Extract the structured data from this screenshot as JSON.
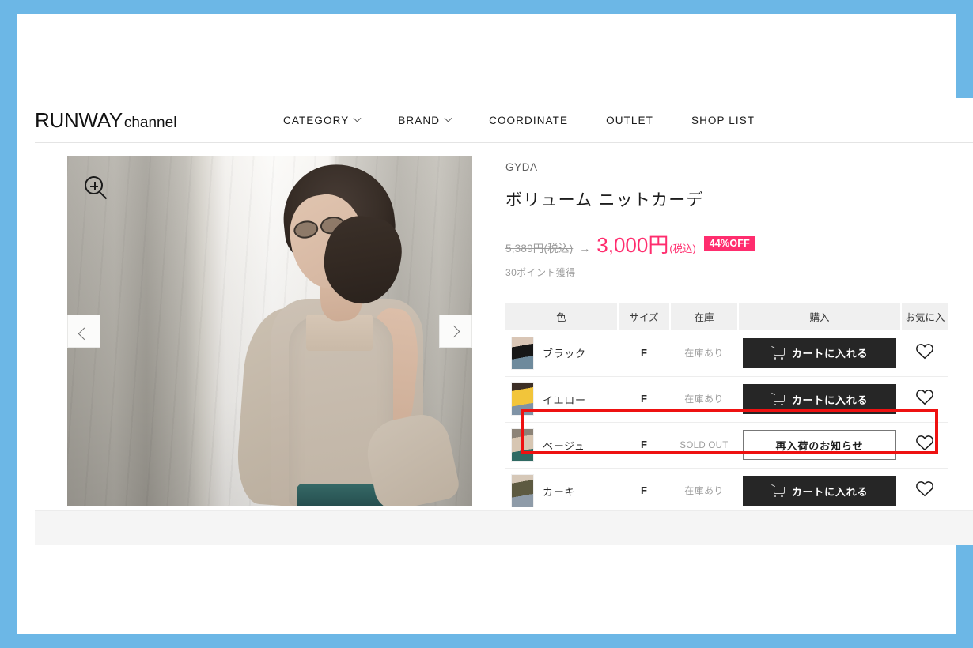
{
  "frame": {
    "border_color": "#6cb7e6",
    "page_bg": "#ffffff"
  },
  "header": {
    "logo_main": "RUNWAY",
    "logo_sub": "channel",
    "nav": [
      {
        "label": "CATEGORY",
        "has_dropdown": true
      },
      {
        "label": "BRAND",
        "has_dropdown": true
      },
      {
        "label": "COORDINATE",
        "has_dropdown": false
      },
      {
        "label": "OUTLET",
        "has_dropdown": false
      },
      {
        "label": "SHOP LIST",
        "has_dropdown": false
      }
    ]
  },
  "gallery": {
    "zoom_icon": "magnifier-plus-icon",
    "prev_label": "‹",
    "next_label": "›"
  },
  "product": {
    "brand": "GYDA",
    "title": "ボリューム ニットカーデ",
    "price_original": "5,389円(税込)",
    "price_arrow": "→",
    "price_sale_amount": "3,000",
    "price_sale_yen": "円",
    "price_sale_tax": "(税込)",
    "discount_badge": "44%OFF",
    "points": "30ポイント獲得",
    "accent_color": "#ff2d6e"
  },
  "variants_table": {
    "headers": [
      "色",
      "サイズ",
      "在庫",
      "購入",
      "お気に入"
    ],
    "rows": [
      {
        "color": "ブラック",
        "swatch": "swatch-black",
        "size": "F",
        "stock": "在庫あり",
        "in_stock": true,
        "action": "カートに入れる",
        "favorite_icon": "heart-outline-icon",
        "highlighted": false
      },
      {
        "color": "イエロー",
        "swatch": "swatch-yellow",
        "size": "F",
        "stock": "在庫あり",
        "in_stock": true,
        "action": "カートに入れる",
        "favorite_icon": "heart-outline-icon",
        "highlighted": false
      },
      {
        "color": "ベージュ",
        "swatch": "swatch-beige",
        "size": "F",
        "stock": "SOLD OUT",
        "in_stock": false,
        "action": "再入荷のお知らせ",
        "favorite_icon": "heart-outline-icon",
        "highlighted": true
      },
      {
        "color": "カーキ",
        "swatch": "swatch-khaki",
        "size": "F",
        "stock": "在庫あり",
        "in_stock": true,
        "action": "カートに入れる",
        "favorite_icon": "heart-outline-icon",
        "highlighted": false
      }
    ]
  },
  "annotation": {
    "highlight_color": "#ee1111",
    "target_row_index": 2
  }
}
